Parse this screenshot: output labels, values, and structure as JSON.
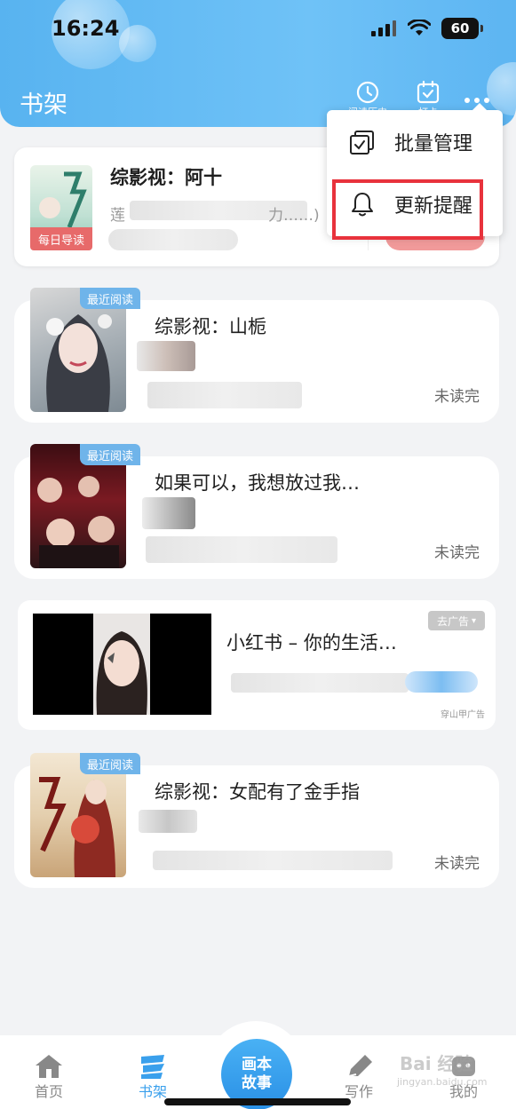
{
  "status_bar": {
    "time": "16:24",
    "battery": "60"
  },
  "header": {
    "title": "书架",
    "history_label": "阅读历史",
    "checkin_label": "打卡"
  },
  "menu": {
    "items": [
      {
        "label": "批量管理",
        "icon": "batch-check-icon"
      },
      {
        "label": "更新提醒",
        "icon": "bell-icon"
      }
    ]
  },
  "daily_book": {
    "tag": "每日导读",
    "title": "综影视：阿十",
    "desc_start": "莲",
    "desc_end": "力……)"
  },
  "books": [
    {
      "title": "综影视：山栀",
      "tag": "最近阅读",
      "status": "未读完"
    },
    {
      "title": "如果可以，我想放过我…",
      "tag": "最近阅读",
      "status": "未读完"
    },
    {
      "title": "综影视：女配有了金手指",
      "tag": "最近阅读",
      "status": "未读完"
    }
  ],
  "ad": {
    "title": "小红书 – 你的生活…",
    "remove_label": "去广告",
    "source": "穿山甲广告"
  },
  "nav": {
    "home": "首页",
    "bookshelf": "书架",
    "center_line1": "画本",
    "center_line2": "故事",
    "write": "写作",
    "mine": "我的"
  },
  "watermark": {
    "main": "Bai 经验",
    "sub": "jingyan.baidu.com"
  },
  "colors": {
    "accent": "#3aa0ec",
    "highlight": "#e8323c",
    "daily_tag": "#e76a6a"
  }
}
